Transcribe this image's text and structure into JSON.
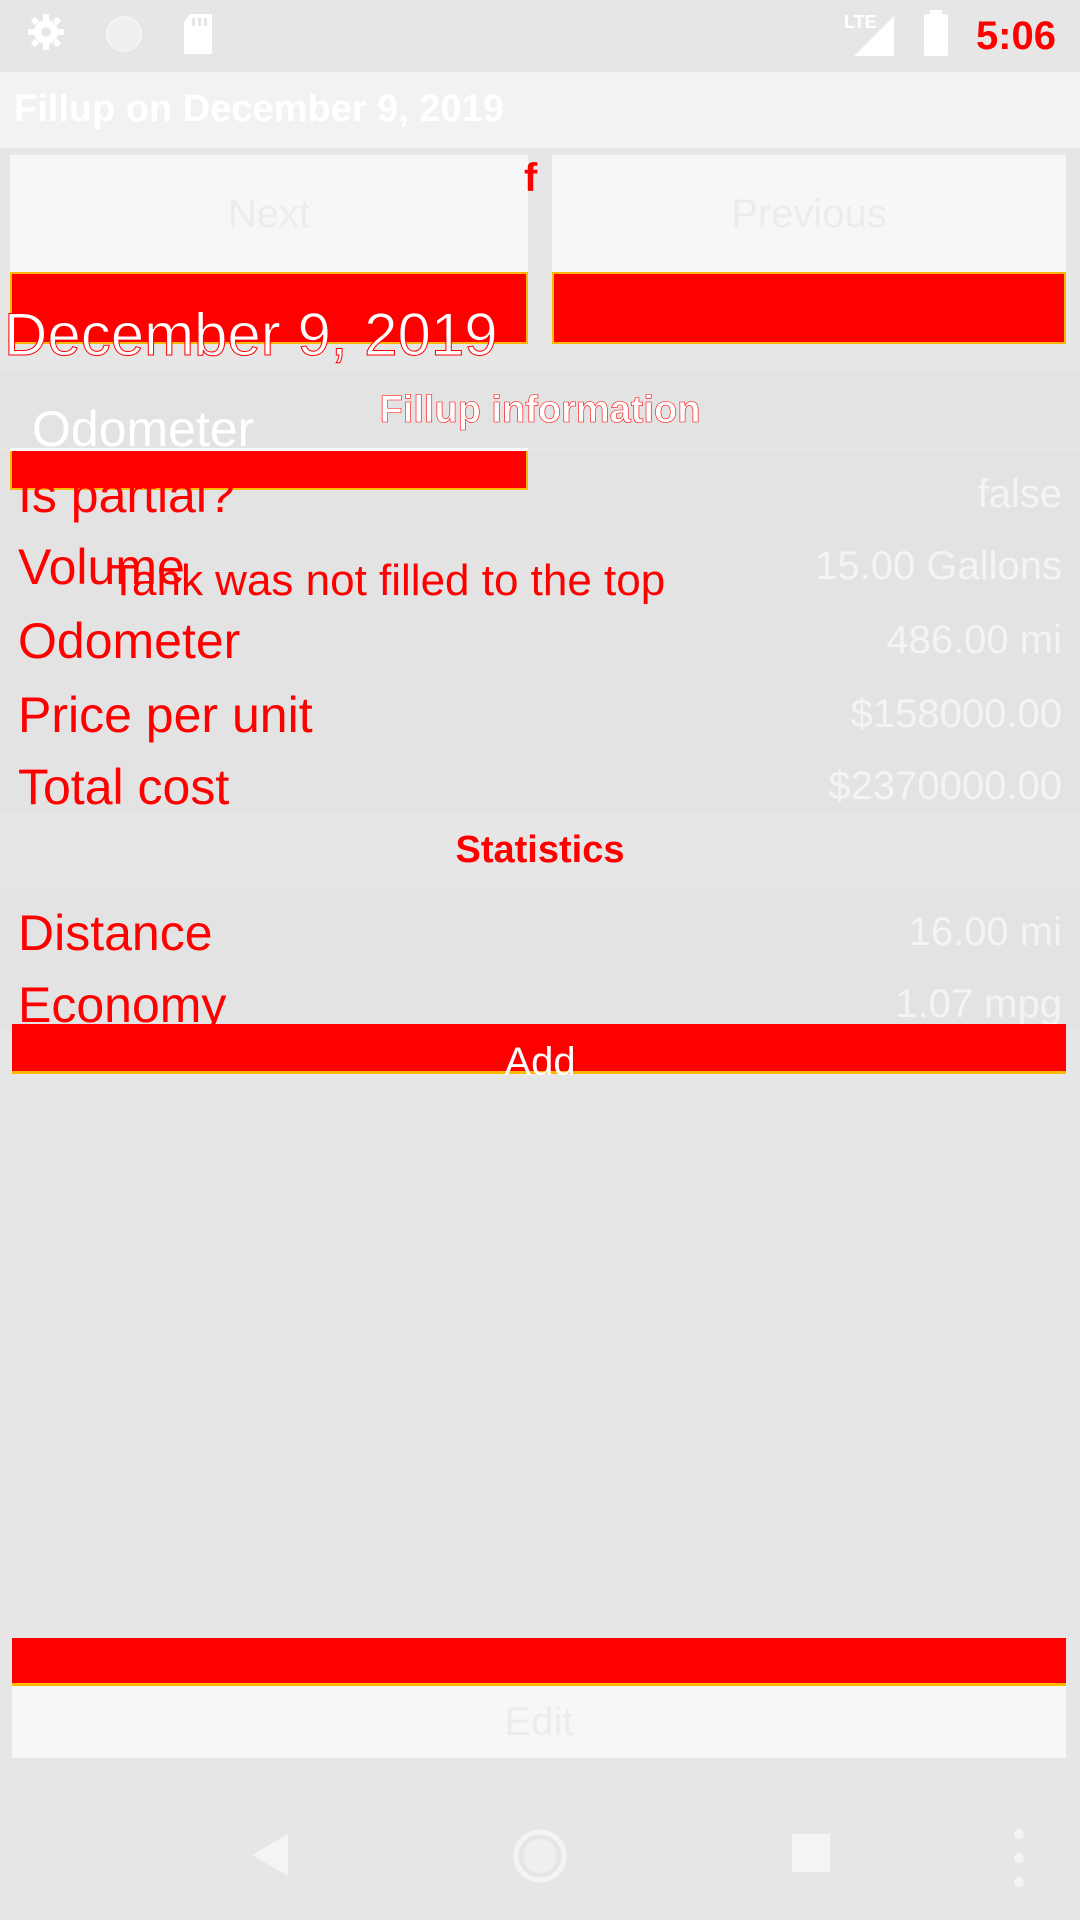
{
  "status_bar": {
    "time": "5:06",
    "icons": [
      "gear-icon",
      "circle-icon",
      "sd-card-icon",
      "lte-signal-icon",
      "battery-icon"
    ],
    "network_label": "LTE"
  },
  "app_bar": {
    "title": "Fillup on December 9, 2019"
  },
  "nav_buttons": {
    "next_label": "Next",
    "previous_label": "Previous"
  },
  "overlay": {
    "date": "December 9, 2019",
    "odometer_label": "Odometer",
    "stray_char": "f",
    "partial_note": "Tank was not filled to the top"
  },
  "fillup_section": {
    "header": "Fillup information",
    "rows": [
      {
        "label": "Is partial?",
        "value": "false"
      },
      {
        "label": "Volume",
        "value": "15.00 Gallons"
      },
      {
        "label": "Odometer",
        "value": "486.00 mi"
      },
      {
        "label": "Price per unit",
        "value": "$158000.00"
      },
      {
        "label": "Total cost",
        "value": "$2370000.00"
      }
    ]
  },
  "stats_section": {
    "header": "Statistics",
    "rows": [
      {
        "label": "Distance",
        "value": "16.00 mi"
      },
      {
        "label": "Economy",
        "value": "1.07 mpg"
      }
    ]
  },
  "actions": {
    "add_label": "Add",
    "edit_label": "Edit"
  },
  "colors": {
    "accent": "#ff0000",
    "outline": "#ffb800",
    "background": "#e6e6e6"
  }
}
